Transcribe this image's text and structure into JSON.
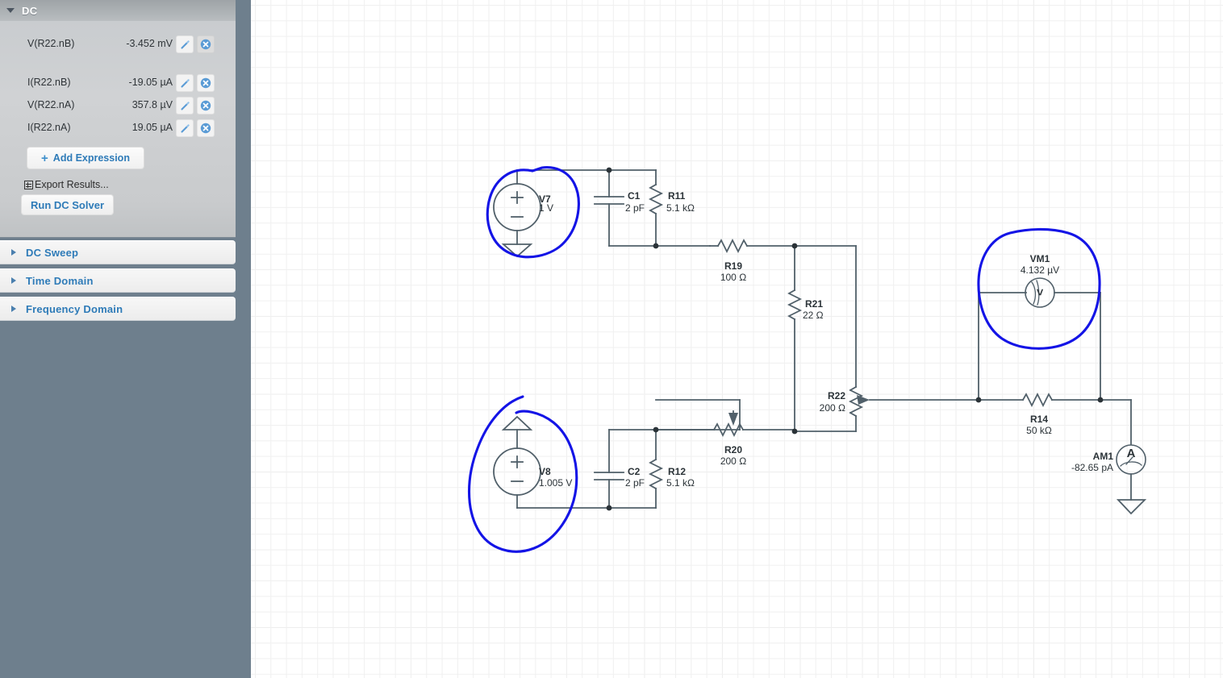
{
  "sidebar": {
    "dc_panel": {
      "title": "DC",
      "collapse_icon": "triangle-down-icon",
      "expressions": [
        {
          "name": "V(R22.nB)",
          "value": "-3.452 mV",
          "edit_icon": "wand-icon",
          "delete_icon": "remove-circle-icon"
        },
        {
          "name": "I(R22.nB)",
          "value": "-19.05 µA",
          "edit_icon": "wand-icon",
          "delete_icon": "remove-circle-icon"
        },
        {
          "name": "V(R22.nA)",
          "value": "357.8 µV",
          "edit_icon": "wand-icon",
          "delete_icon": "remove-circle-icon"
        },
        {
          "name": "I(R22.nA)",
          "value": "19.05 µA",
          "edit_icon": "wand-icon",
          "delete_icon": "remove-circle-icon"
        }
      ],
      "add_expression_label": "Add Expression",
      "add_expression_icon": "plus-icon",
      "export_results_label": "Export Results...",
      "export_results_icon": "table-icon",
      "run_solver_label": "Run DC Solver"
    },
    "sections": [
      {
        "label": "DC Sweep",
        "expand_icon": "triangle-right-icon"
      },
      {
        "label": "Time Domain",
        "expand_icon": "triangle-right-icon"
      },
      {
        "label": "Frequency Domain",
        "expand_icon": "triangle-right-icon"
      }
    ]
  },
  "colors": {
    "accent_link": "#2e7bb8",
    "annotation": "#1414e6",
    "wire": "#51606a",
    "panel_bg": "#6e7f8d"
  },
  "schematic": {
    "components": [
      {
        "ref": "V7",
        "value": "1 V",
        "type": "voltage-source"
      },
      {
        "ref": "C1",
        "value": "2 pF",
        "type": "capacitor"
      },
      {
        "ref": "R11",
        "value": "5.1 kΩ",
        "type": "resistor"
      },
      {
        "ref": "R19",
        "value": "100 Ω",
        "type": "resistor"
      },
      {
        "ref": "R21",
        "value": "22 Ω",
        "type": "resistor"
      },
      {
        "ref": "R22",
        "value": "200 Ω",
        "type": "potentiometer"
      },
      {
        "ref": "V8",
        "value": "1.005 V",
        "type": "voltage-source"
      },
      {
        "ref": "C2",
        "value": "2 pF",
        "type": "capacitor"
      },
      {
        "ref": "R12",
        "value": "5.1 kΩ",
        "type": "resistor"
      },
      {
        "ref": "R20",
        "value": "200 Ω",
        "type": "potentiometer"
      },
      {
        "ref": "R14",
        "value": "50 kΩ",
        "type": "resistor"
      },
      {
        "ref": "VM1",
        "value": "4.132 µV",
        "type": "voltmeter"
      },
      {
        "ref": "AM1",
        "value": "-82.65 pA",
        "type": "ammeter"
      }
    ],
    "labels": {
      "v7_ref": "V7",
      "v7_val": "1 V",
      "c1_ref": "C1",
      "c1_val": "2 pF",
      "r11_ref": "R11",
      "r11_val": "5.1 kΩ",
      "r19_ref": "R19",
      "r19_val": "100 Ω",
      "r21_ref": "R21",
      "r21_val": "22 Ω",
      "r22_ref": "R22",
      "r22_val": "200 Ω",
      "v8_ref": "V8",
      "v8_val": "1.005 V",
      "c2_ref": "C2",
      "c2_val": "2 pF",
      "r12_ref": "R12",
      "r12_val": "5.1 kΩ",
      "r20_ref": "R20",
      "r20_val": "200 Ω",
      "r14_ref": "R14",
      "r14_val": "50 kΩ",
      "vm1_ref": "VM1",
      "vm1_val": "4.132 µV",
      "am1_ref": "AM1",
      "am1_val": "-82.65 pA"
    },
    "annotations": [
      {
        "name": "ink-circle-expressions",
        "target": "dc-expressions-panel"
      },
      {
        "name": "ink-circle-v7",
        "target": "V7"
      },
      {
        "name": "ink-circle-v8",
        "target": "V8"
      },
      {
        "name": "ink-circle-vm1",
        "target": "VM1"
      }
    ]
  }
}
